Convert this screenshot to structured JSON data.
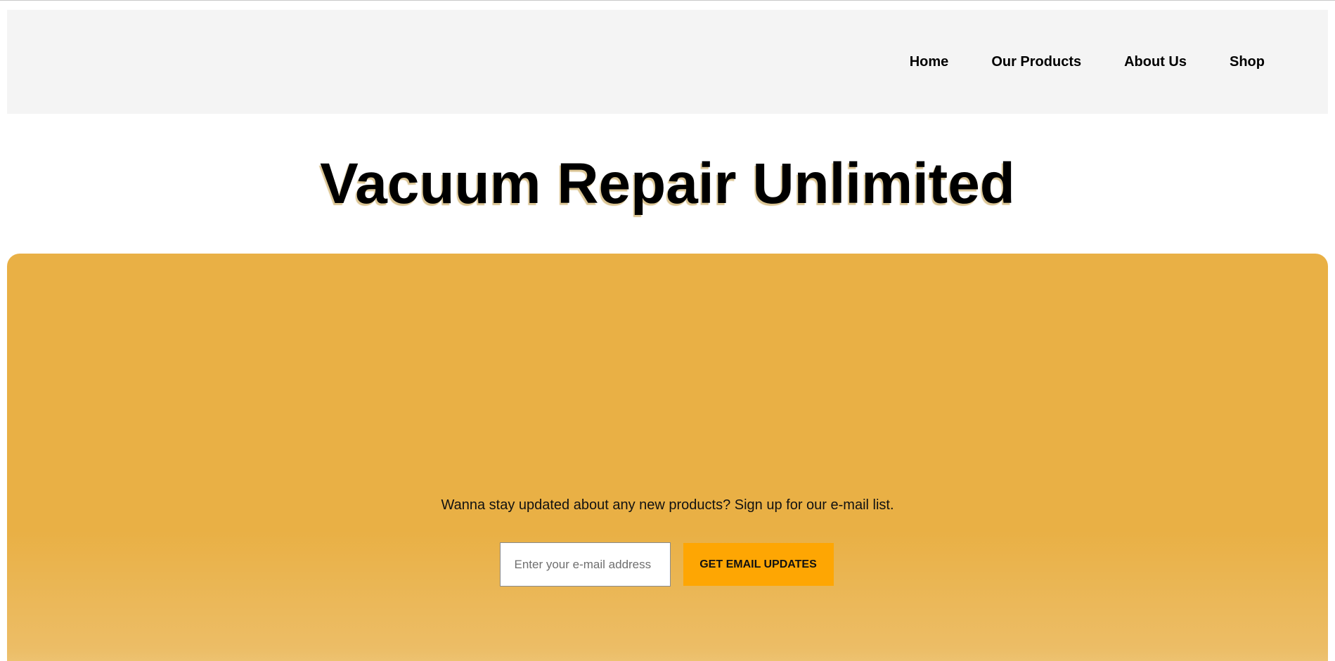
{
  "nav": {
    "items": [
      {
        "label": "Home"
      },
      {
        "label": "Our Products"
      },
      {
        "label": "About Us"
      },
      {
        "label": "Shop"
      }
    ]
  },
  "page": {
    "title": "Vacuum Repair Unlimited"
  },
  "signup": {
    "prompt": "Wanna stay updated about any new products? Sign up for our e-mail list.",
    "email_placeholder": "Enter your e-mail address",
    "email_value": "",
    "button_label": "GET EMAIL UPDATES"
  },
  "colors": {
    "header_bg": "#f4f4f4",
    "hero_bg": "#e9b045",
    "button_bg": "#fea603"
  }
}
